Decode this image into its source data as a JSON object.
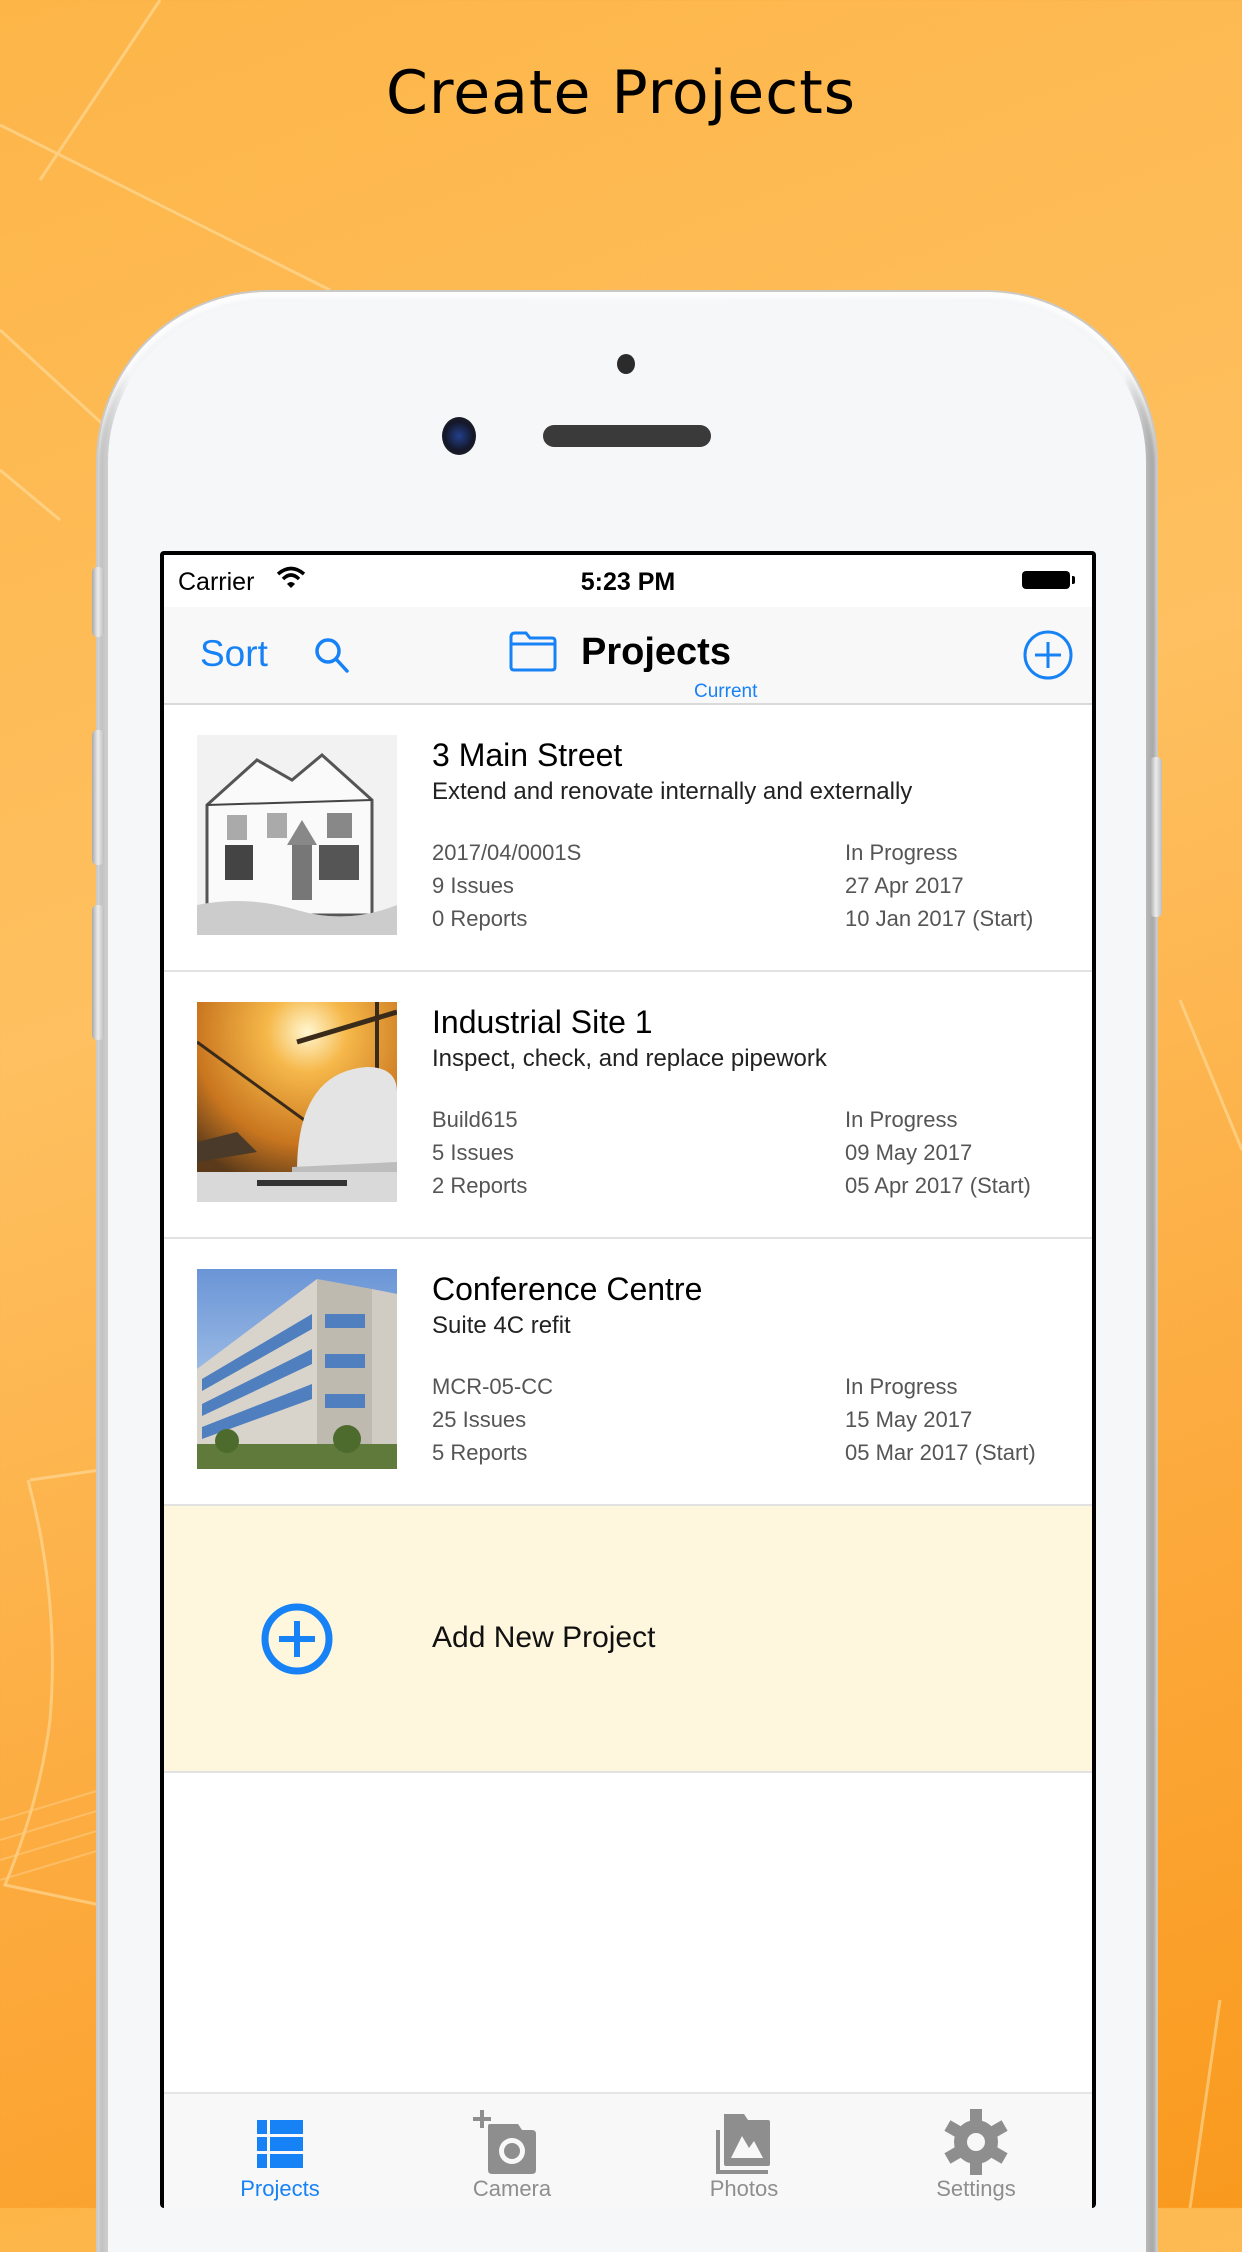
{
  "headline": "Create Projects",
  "status_bar": {
    "carrier": "Carrier",
    "time": "5:23 PM"
  },
  "nav_bar": {
    "sort_label": "Sort",
    "title": "Projects",
    "subtitle": "Current",
    "icons": {
      "search": "search-icon",
      "folder": "folder-icon",
      "add": "plus-circle-icon"
    }
  },
  "projects": [
    {
      "name": "3 Main Street",
      "description": "Extend and renovate internally and externally",
      "reference": "2017/04/0001S",
      "issues": "9 Issues",
      "reports": "0 Reports",
      "status": "In Progress",
      "date": "27 Apr 2017",
      "start": "10 Jan 2017 (Start)",
      "thumbnail": "house-sketch"
    },
    {
      "name": "Industrial Site 1",
      "description": "Inspect, check, and replace pipework",
      "reference": "Build615",
      "issues": "5 Issues",
      "reports": "2 Reports",
      "status": "In Progress",
      "date": "09 May 2017",
      "start": "05 Apr 2017 (Start)",
      "thumbnail": "hard-hat-cranes"
    },
    {
      "name": "Conference Centre",
      "description": "Suite 4C refit",
      "reference": "MCR-05-CC",
      "issues": "25 Issues",
      "reports": "5 Reports",
      "status": "In Progress",
      "date": "15 May 2017",
      "start": "05 Mar 2017 (Start)",
      "thumbnail": "office-building"
    }
  ],
  "add_project": {
    "label": "Add New Project"
  },
  "tab_bar": {
    "active": "Projects",
    "tabs": [
      {
        "label": "Projects",
        "icon": "list-icon"
      },
      {
        "label": "Camera",
        "icon": "camera-add-icon"
      },
      {
        "label": "Photos",
        "icon": "photos-icon"
      },
      {
        "label": "Settings",
        "icon": "gear-icon"
      }
    ]
  },
  "colors": {
    "accent": "#1782F5",
    "inactive_tab": "#8E8E8E",
    "add_row_bg": "#FEF7DD",
    "background": "#FDB548"
  }
}
